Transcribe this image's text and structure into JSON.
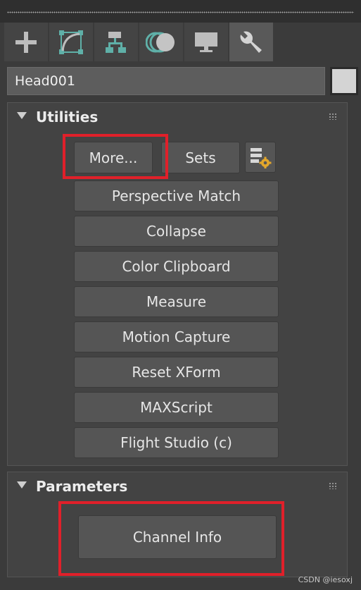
{
  "tabs": [
    {
      "icon": "create-plus-icon",
      "active": false
    },
    {
      "icon": "modify-curve-icon",
      "active": false
    },
    {
      "icon": "hierarchy-icon",
      "active": false
    },
    {
      "icon": "motion-circles-icon",
      "active": false
    },
    {
      "icon": "display-monitor-icon",
      "active": false
    },
    {
      "icon": "utilities-wrench-icon",
      "active": true
    }
  ],
  "object": {
    "name": "Head001",
    "color": "#d4d4d4"
  },
  "utilities": {
    "title": "Utilities",
    "more_label": "More...",
    "sets_label": "Sets",
    "config_icon": "configure-sets-icon",
    "buttons": [
      "Perspective Match",
      "Collapse",
      "Color Clipboard",
      "Measure",
      "Motion Capture",
      "Reset XForm",
      "MAXScript",
      "Flight Studio (c)"
    ]
  },
  "parameters": {
    "title": "Parameters",
    "channel_info_label": "Channel Info"
  },
  "annotation_color": "#e0202a",
  "watermark": "CSDN @iesoxj"
}
